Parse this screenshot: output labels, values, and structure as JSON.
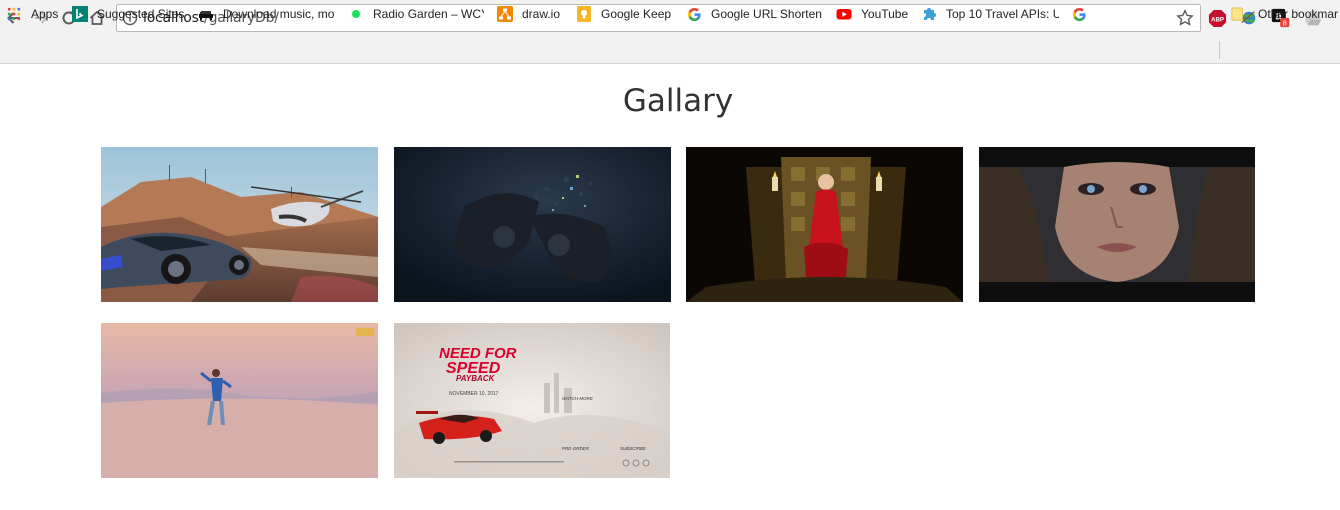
{
  "browser": {
    "url_host": "localhost",
    "url_path": "/gallaryDb/",
    "icons": {
      "back": "back-arrow-icon",
      "forward": "forward-arrow-icon",
      "reload": "reload-icon",
      "home": "home-icon",
      "info": "info-icon",
      "star": "star-icon"
    },
    "extensions": [
      {
        "name": "adblock-plus-icon",
        "label": "ABP"
      },
      {
        "name": "globe-extension-icon",
        "label": ""
      },
      {
        "name": "amazon-extension-icon",
        "label": "a",
        "badge": "8"
      },
      {
        "name": "drive-extension-icon",
        "label": ""
      }
    ]
  },
  "bookmarks": {
    "items": [
      {
        "label": "Apps",
        "icon": "apps-grid-icon"
      },
      {
        "label": "Suggested Sites",
        "icon": "bing-icon"
      },
      {
        "label": "Download music, mo",
        "icon": "sofa-icon"
      },
      {
        "label": "Radio Garden – WCY",
        "icon": "green-dot-icon"
      },
      {
        "label": "draw.io",
        "icon": "drawio-icon"
      },
      {
        "label": "Google Keep",
        "icon": "keep-bulb-icon"
      },
      {
        "label": "Google URL Shorten",
        "icon": "google-g-icon"
      },
      {
        "label": "YouTube",
        "icon": "youtube-icon"
      },
      {
        "label": "Top 10 Travel APIs: U",
        "icon": "puzzle-icon"
      },
      {
        "label": "",
        "icon": "google-g-icon"
      }
    ],
    "other": {
      "label": "Other bookmar",
      "icon": "folder-icon"
    }
  },
  "page": {
    "title": "Gallary",
    "images": [
      {
        "name": "gallery-image-racing-helicopter",
        "subject": "racing car and helicopter in desert"
      },
      {
        "name": "gallery-image-game-controller",
        "subject": "shattering game controller"
      },
      {
        "name": "gallery-image-throne-red-dress",
        "subject": "woman in red dress on golden throne"
      },
      {
        "name": "gallery-image-face-closeup",
        "subject": "close-up of a woman's face"
      },
      {
        "name": "gallery-image-desert-dancer",
        "subject": "man dancing in pink desert"
      },
      {
        "name": "gallery-image-nfs-payback-poster",
        "subject": "Need for Speed Payback poster"
      }
    ],
    "poster": {
      "logo_line1": "NEED FOR",
      "logo_line2": "SPEED",
      "logo_line3": "PAYBACK",
      "date": "NOVEMBER 10, 2017",
      "watch": "WATCH MORE",
      "preorder": "PRE-ORDER",
      "subscribe": "SUBSCRIBE"
    }
  },
  "colors": {
    "toolbar_bg": "#f2f2f2",
    "abp_red": "#c70d2c",
    "youtube_red": "#ff0000",
    "nfs_red": "#d8002c"
  }
}
